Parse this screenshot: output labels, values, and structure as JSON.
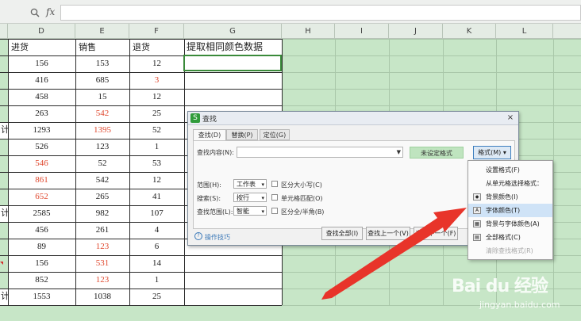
{
  "formula_bar": {
    "fx_label": "fx",
    "value": ""
  },
  "columns": [
    "D",
    "E",
    "F",
    "G",
    "H",
    "I",
    "J",
    "K",
    "L"
  ],
  "table": {
    "headers": {
      "d": "进货",
      "e": "销售",
      "f": "退货",
      "g": "提取相同颜色数据"
    },
    "rows": [
      {
        "d": "156",
        "e": "153",
        "f": "12",
        "red": ""
      },
      {
        "d": "416",
        "e": "685",
        "f": "3",
        "red": "f"
      },
      {
        "d": "458",
        "e": "15",
        "f": "12",
        "red": ""
      },
      {
        "d": "263",
        "e": "542",
        "f": "25",
        "red": "e"
      },
      {
        "d": "1293",
        "e": "1395",
        "f": "52",
        "red": "e",
        "frag": "计"
      },
      {
        "d": "526",
        "e": "123",
        "f": "1",
        "red": ""
      },
      {
        "d": "546",
        "e": "52",
        "f": "53",
        "red": "d"
      },
      {
        "d": "861",
        "e": "542",
        "f": "12",
        "red": "d"
      },
      {
        "d": "652",
        "e": "265",
        "f": "41",
        "red": "d"
      },
      {
        "d": "2585",
        "e": "982",
        "f": "107",
        "red": "",
        "frag": "计"
      },
      {
        "d": "456",
        "e": "261",
        "f": "4",
        "red": ""
      },
      {
        "d": "89",
        "e": "123",
        "f": "6",
        "red": "e"
      },
      {
        "d": "156",
        "e": "531",
        "f": "14",
        "red": "e"
      },
      {
        "d": "852",
        "e": "123",
        "f": "1",
        "red": "e"
      },
      {
        "d": "1553",
        "e": "1038",
        "f": "25",
        "red": "",
        "frag": "计"
      }
    ]
  },
  "dialog": {
    "logo": "S",
    "title": "查找",
    "close": "×",
    "tabs": [
      "查找(D)",
      "替换(P)",
      "定位(G)"
    ],
    "find_label": "查找内容(N):",
    "find_value": "",
    "format_status": "未设定格式",
    "format_button": "格式(M) ▾",
    "scope_label": "范围(H):",
    "scope_value": "工作表",
    "search_label": "搜索(S):",
    "search_value": "按行",
    "lookin_label": "查找范围(L):",
    "lookin_value": "智能",
    "match_case": "区分大小写(C)",
    "match_cell": "单元格匹配(O)",
    "match_width": "区分全/半角(B)",
    "tips": "操作技巧",
    "find_all": "查找全部(I)",
    "find_prev": "查找上一个(V)",
    "find_next": "查找下一个(F)"
  },
  "menu": {
    "items": [
      {
        "label": "设置格式(F)",
        "state": "normal"
      },
      {
        "label": "从单元格选择格式：",
        "state": "normal"
      },
      {
        "label": "背景颜色(I)",
        "state": "normal"
      },
      {
        "label": "字体颜色(T)",
        "state": "highlighted"
      },
      {
        "label": "背景与字体颜色(A)",
        "state": "normal"
      },
      {
        "label": "全部格式(C)",
        "state": "normal"
      },
      {
        "label": "清除查找格式(R)",
        "state": "disabled"
      }
    ]
  },
  "watermark": {
    "logo": "Bai du 经验",
    "url": "jingyan.baidu.com"
  },
  "colors": {
    "sheet_bg": "#c7e6c7",
    "red_text": "#e0492f",
    "arrow": "#e8342a",
    "selection": "#3a8a3a"
  }
}
